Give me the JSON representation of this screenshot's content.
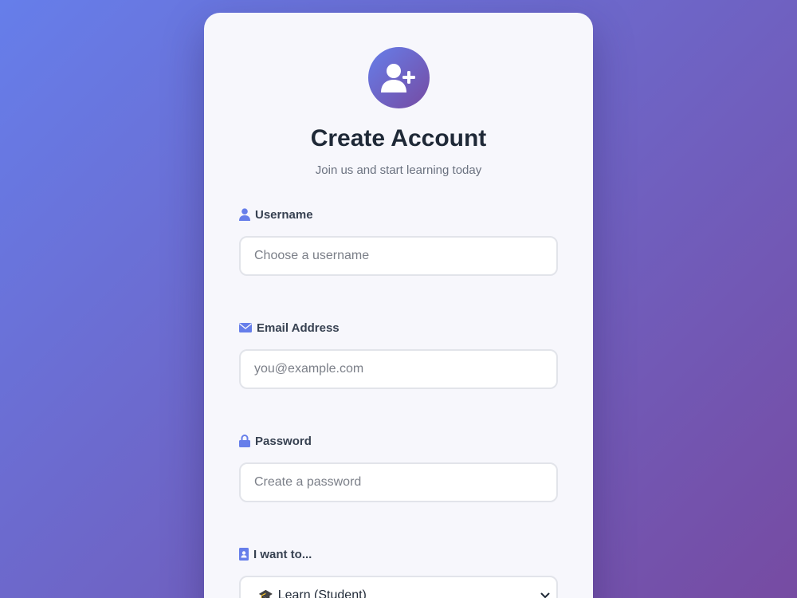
{
  "header": {
    "avatar_icon": "user-plus-icon",
    "title": "Create Account",
    "subtitle": "Join us and start learning today"
  },
  "form": {
    "username": {
      "icon": "user-icon",
      "label": "Username",
      "placeholder": "Choose a username",
      "value": ""
    },
    "email": {
      "icon": "envelope-icon",
      "label": "Email Address",
      "placeholder": "you@example.com",
      "value": ""
    },
    "password": {
      "icon": "lock-icon",
      "label": "Password",
      "placeholder": "Create a password",
      "value": ""
    },
    "role": {
      "icon": "id-badge-icon",
      "label": "I want to...",
      "selected_icon": "🎓",
      "selected": "Learn (Student)"
    }
  },
  "colors": {
    "gradient_start": "#667eea",
    "gradient_end": "#764ba2",
    "accent_icon": "#667eea",
    "title": "#1f2937"
  }
}
